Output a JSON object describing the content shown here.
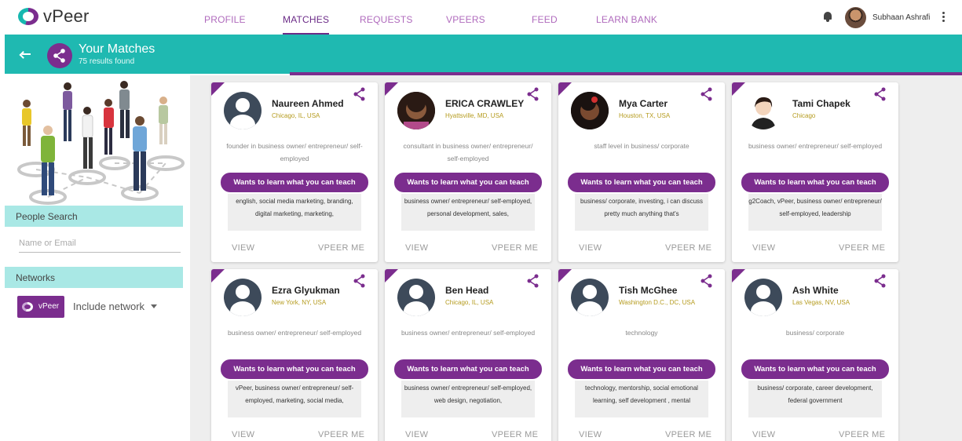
{
  "brand": {
    "name": "vPeer",
    "accent": "#7b2d8e",
    "teal": "#1fb9b1"
  },
  "nav": {
    "items": [
      {
        "label": "PROFILE",
        "active": false
      },
      {
        "label": "MATCHES",
        "active": true
      },
      {
        "label": "REQUESTS",
        "active": false
      },
      {
        "label": "VPEERS",
        "active": false
      },
      {
        "label": "FEED",
        "active": false
      },
      {
        "label": "LEARN BANK",
        "active": false
      }
    ],
    "user_name": "Subhaan Ashrafi",
    "icons": [
      "bell-icon",
      "kebab-menu-icon"
    ]
  },
  "header": {
    "title": "Your Matches",
    "subtitle": "75 results found",
    "icons": [
      "back-arrow-icon",
      "share-icon"
    ]
  },
  "sidebar": {
    "people_search_label": "People Search",
    "search_placeholder": "Name or Email",
    "networks_label": "Networks",
    "network_chip": "vPeer",
    "include_label": "Include network"
  },
  "cards": [
    {
      "name": "Naureen Ahmed",
      "location": "Chicago, IL, USA",
      "description": "founder in business owner/ entrepreneur/ self-employed",
      "button": "Wants to learn what you can teach",
      "skills": "english, social media marketing, branding, digital marketing, marketing,",
      "view": "VIEW",
      "vpeer": "VPEER ME",
      "avatar": "default"
    },
    {
      "name": "ERICA CRAWLEY",
      "location": "Hyattsville, MD, USA",
      "description": "consultant in business owner/ entrepreneur/ self-employed",
      "button": "Wants to learn what you can teach",
      "skills": "business owner/ entrepreneur/ self-employed, personal development, sales,",
      "view": "VIEW",
      "vpeer": "VPEER ME",
      "avatar": "photo"
    },
    {
      "name": "Mya Carter",
      "location": "Houston, TX, USA",
      "description": "staff level in business/ corporate",
      "button": "Wants to learn what you can teach",
      "skills": "business/ corporate, investing, i can discuss pretty much anything that's",
      "view": "VIEW",
      "vpeer": "VPEER ME",
      "avatar": "photo"
    },
    {
      "name": "Tami Chapek",
      "location": "Chicago",
      "description": "business owner/ entrepreneur/ self-employed",
      "button": "Wants to learn what you can teach",
      "skills": "g2Coach, vPeer, business owner/ entrepreneur/ self-employed, leadership",
      "view": "VIEW",
      "vpeer": "VPEER ME",
      "avatar": "photo"
    },
    {
      "name": "Ezra Glyukman",
      "location": "New York, NY, USA",
      "description": "business owner/ entrepreneur/ self-employed",
      "button": "Wants to learn what you can teach",
      "skills": "vPeer, business owner/ entrepreneur/ self-employed, marketing, social media,",
      "view": "VIEW",
      "vpeer": "VPEER ME",
      "avatar": "default"
    },
    {
      "name": "Ben Head",
      "location": "Chicago, IL, USA",
      "description": "business owner/ entrepreneur/ self-employed",
      "button": "Wants to learn what you can teach",
      "skills": "business owner/ entrepreneur/ self-employed, web design, negotiation,",
      "view": "VIEW",
      "vpeer": "VPEER ME",
      "avatar": "default"
    },
    {
      "name": "Tish McGhee",
      "location": "Washington D.C., DC, USA",
      "description": "technology",
      "button": "Wants to learn what you can teach",
      "skills": "technology, mentorship, social emotional learning, self development , mental",
      "view": "VIEW",
      "vpeer": "VPEER ME",
      "avatar": "default"
    },
    {
      "name": "Ash White",
      "location": "Las Vegas, NV, USA",
      "description": "business/ corporate",
      "button": "Wants to learn what you can teach",
      "skills": "business/ corporate, career development, federal government",
      "view": "VIEW",
      "vpeer": "VPEER ME",
      "avatar": "default"
    }
  ]
}
